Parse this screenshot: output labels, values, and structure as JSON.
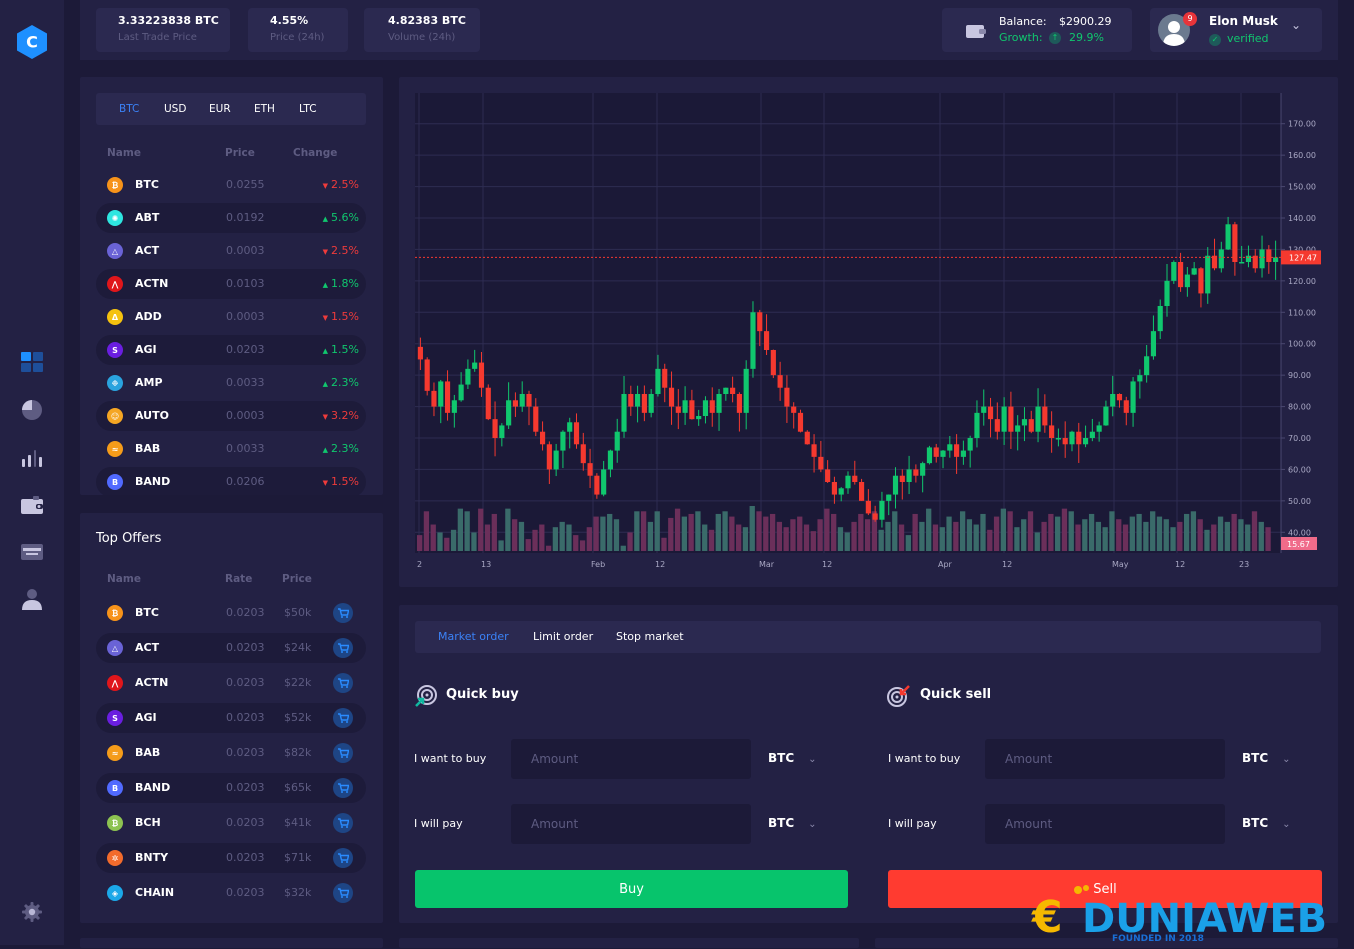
{
  "sidebar": {
    "logo_letter": "C",
    "items": [
      {
        "name": "dashboard",
        "active": true
      },
      {
        "name": "pie-chart",
        "active": false
      },
      {
        "name": "bar-chart",
        "active": false
      },
      {
        "name": "wallet",
        "active": false
      },
      {
        "name": "card",
        "active": false
      },
      {
        "name": "user",
        "active": false
      }
    ],
    "settings": "settings"
  },
  "topbar": {
    "stats": [
      {
        "value": "3.33223838 BTC",
        "label": "Last Trade Price"
      },
      {
        "value": "4.55%",
        "label": "Price (24h)"
      },
      {
        "value": "4.82383 BTC",
        "label": "Volume (24h)"
      }
    ],
    "balance": {
      "label": "Balance:",
      "value": "$2900.29",
      "growth_label": "Growth:",
      "growth_value": "29.9%"
    },
    "user": {
      "name": "Elon Musk",
      "status": "verified",
      "notifications": "9"
    }
  },
  "market": {
    "tabs": [
      "BTC",
      "USD",
      "EUR",
      "ETH",
      "LTC"
    ],
    "active_tab": "BTC",
    "headers": {
      "name": "Name",
      "price": "Price",
      "change": "Change"
    },
    "rows": [
      {
        "symbol": "BTC",
        "price": "0.0255",
        "change": "2.5%",
        "dir": "down",
        "color": "#f7931a",
        "glyph": "₿"
      },
      {
        "symbol": "ABT",
        "price": "0.0192",
        "change": "5.6%",
        "dir": "up",
        "color": "#2ee6e0",
        "glyph": "✺"
      },
      {
        "symbol": "ACT",
        "price": "0.0003",
        "change": "2.5%",
        "dir": "down",
        "color": "#6a63d6",
        "glyph": "△"
      },
      {
        "symbol": "ACTN",
        "price": "0.0103",
        "change": "1.8%",
        "dir": "up",
        "color": "#e0161b",
        "glyph": "⋀"
      },
      {
        "symbol": "ADD",
        "price": "0.0003",
        "change": "1.5%",
        "dir": "down",
        "color": "#f5c20f",
        "glyph": "Δ"
      },
      {
        "symbol": "AGI",
        "price": "0.0203",
        "change": "1.5%",
        "dir": "up",
        "color": "#6a1ee0",
        "glyph": "S"
      },
      {
        "symbol": "AMP",
        "price": "0.0033",
        "change": "2.3%",
        "dir": "up",
        "color": "#2aa3de",
        "glyph": "❉"
      },
      {
        "symbol": "AUTO",
        "price": "0.0003",
        "change": "3.2%",
        "dir": "down",
        "color": "#f5a623",
        "glyph": "☺"
      },
      {
        "symbol": "BAB",
        "price": "0.0033",
        "change": "2.3%",
        "dir": "up",
        "color": "#f59c1a",
        "glyph": "≈"
      },
      {
        "symbol": "BAND",
        "price": "0.0206",
        "change": "1.5%",
        "dir": "down",
        "color": "#516aff",
        "glyph": "B"
      }
    ]
  },
  "offers": {
    "title": "Top Offers",
    "headers": {
      "name": "Name",
      "rate": "Rate",
      "price": "Price"
    },
    "rows": [
      {
        "symbol": "BTC",
        "rate": "0.0203",
        "price": "$50k",
        "color": "#f7931a",
        "glyph": "₿"
      },
      {
        "symbol": "ACT",
        "rate": "0.0203",
        "price": "$24k",
        "color": "#6a63d6",
        "glyph": "△"
      },
      {
        "symbol": "ACTN",
        "rate": "0.0203",
        "price": "$22k",
        "color": "#e0161b",
        "glyph": "⋀"
      },
      {
        "symbol": "AGI",
        "rate": "0.0203",
        "price": "$52k",
        "color": "#6a1ee0",
        "glyph": "S"
      },
      {
        "symbol": "BAB",
        "rate": "0.0203",
        "price": "$82k",
        "color": "#f59c1a",
        "glyph": "≈"
      },
      {
        "symbol": "BAND",
        "rate": "0.0203",
        "price": "$65k",
        "color": "#516aff",
        "glyph": "B"
      },
      {
        "symbol": "BCH",
        "rate": "0.0203",
        "price": "$41k",
        "color": "#8dc351",
        "glyph": "₿"
      },
      {
        "symbol": "BNTY",
        "rate": "0.0203",
        "price": "$71k",
        "color": "#f26b2c",
        "glyph": "✲"
      },
      {
        "symbol": "CHAIN",
        "rate": "0.0203",
        "price": "$32k",
        "color": "#1ba8e8",
        "glyph": "◈"
      }
    ]
  },
  "chart_data": {
    "type": "candlestick",
    "title": "",
    "y_axis_ticks": [
      "170.00",
      "160.00",
      "150.00",
      "140.00",
      "130.00",
      "120.00",
      "110.00",
      "100.00",
      "90.00",
      "80.00",
      "70.00",
      "60.00",
      "50.00",
      "40.00"
    ],
    "ylim": [
      35,
      175
    ],
    "x_axis_ticks": [
      "2",
      "13",
      "Feb",
      "12",
      "Mar",
      "12",
      "Apr",
      "12",
      "May",
      "12",
      "23"
    ],
    "last_price": "127.47",
    "last_volume": "15.67",
    "colors": {
      "up": "#10c76e",
      "down": "#f5392f",
      "vol_up": "#3a6b6a",
      "vol_down": "#6b2f5a"
    },
    "closes": [
      95,
      85,
      80,
      88,
      78,
      82,
      87,
      92,
      94,
      86,
      76,
      70,
      74,
      82,
      80,
      84,
      80,
      72,
      68,
      60,
      66,
      72,
      75,
      68,
      62,
      58,
      52,
      60,
      66,
      72,
      84,
      80,
      84,
      78,
      84,
      92,
      86,
      80,
      78,
      82,
      76,
      77,
      82,
      78,
      84,
      86,
      84,
      78,
      92,
      110,
      104,
      98,
      90,
      86,
      80,
      78,
      72,
      68,
      64,
      60,
      56,
      52,
      54,
      58,
      56,
      50,
      46,
      44,
      50,
      52,
      58,
      56,
      60,
      58,
      62,
      67,
      64,
      66,
      68,
      64,
      66,
      70,
      78,
      80,
      76,
      72,
      80,
      72,
      74,
      76,
      72,
      80,
      74,
      70,
      70,
      68,
      72,
      68,
      70,
      72,
      74,
      80,
      84,
      82,
      78,
      88,
      90,
      96,
      104,
      112,
      120,
      126,
      118,
      122,
      124,
      116,
      128,
      124,
      130,
      138,
      126,
      126,
      128,
      124,
      130,
      126,
      127.47
    ],
    "volumes": [
      12,
      30,
      20,
      14,
      10,
      16,
      32,
      30,
      14,
      32,
      20,
      28,
      8,
      32,
      24,
      22,
      9,
      16,
      20,
      4,
      18,
      22,
      20,
      12,
      8,
      18,
      26,
      26,
      28,
      24,
      4,
      14,
      30,
      30,
      22,
      30,
      10,
      25,
      32,
      26,
      28,
      30,
      20,
      16,
      28,
      30,
      26,
      20,
      18,
      34,
      30,
      26,
      28,
      22,
      18,
      24,
      26,
      20,
      15,
      24,
      32,
      28,
      18,
      14,
      22,
      28,
      24,
      30,
      16,
      22,
      30,
      20,
      12,
      28,
      22,
      32,
      20,
      18,
      26,
      22,
      30,
      24,
      20,
      28,
      16,
      26,
      32,
      30,
      18,
      24,
      30,
      14,
      22,
      28,
      26,
      32,
      30,
      20,
      24,
      28,
      22,
      18,
      30,
      24,
      20,
      26,
      28,
      22,
      30,
      26,
      24,
      18,
      22,
      28,
      30,
      24,
      16,
      20,
      26,
      22,
      28,
      24,
      20,
      30,
      22,
      18
    ]
  },
  "order": {
    "tabs": [
      "Market order",
      "Limit order",
      "Stop market"
    ],
    "active_tab": "Market order",
    "quick_buy": {
      "title": "Quick buy",
      "want_label": "I want to buy",
      "pay_label": "I will pay",
      "placeholder": "Amount",
      "want_currency": "BTC",
      "pay_currency": "BTC",
      "button": "Buy",
      "button_color": "#07c46c"
    },
    "quick_sell": {
      "title": "Quick sell",
      "want_label": "I want to buy",
      "pay_label": "I will pay",
      "placeholder": "Amount",
      "want_currency": "BTC",
      "pay_currency": "BTC",
      "button": "Sell",
      "button_color": "#ff3b30"
    }
  },
  "watermark": {
    "text": "DUNIAWEB",
    "subtitle": "FOUNDED IN 2018"
  }
}
